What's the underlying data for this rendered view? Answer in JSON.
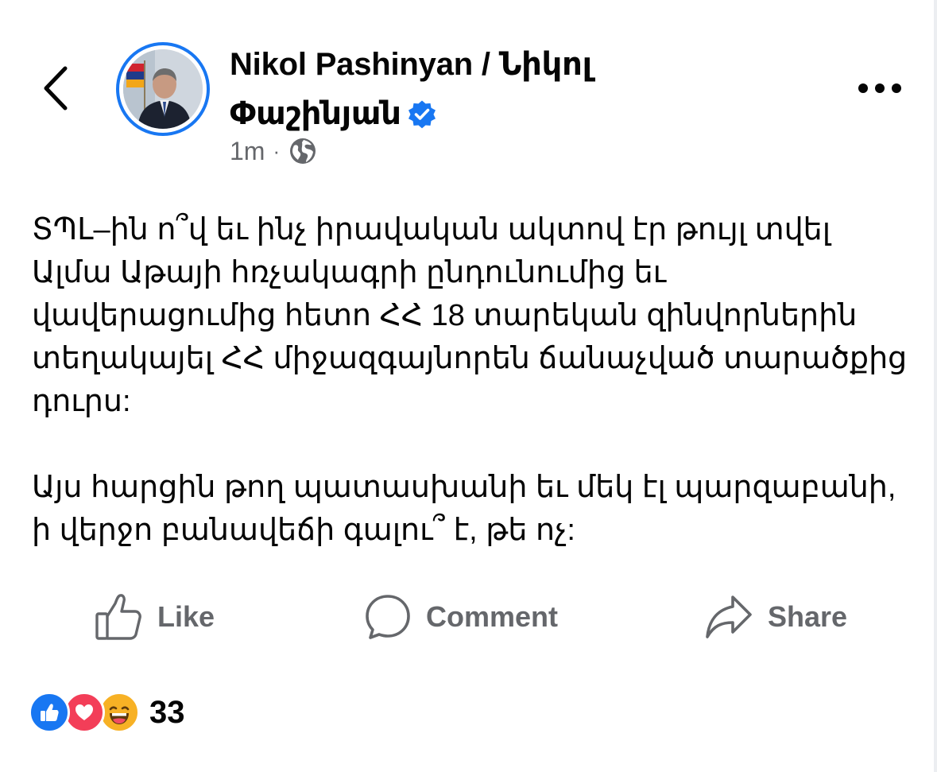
{
  "post": {
    "author": "Nikol Pashinyan / Նիկոլ Փաշինյան",
    "verified": true,
    "time": "1m",
    "privacy_icon": "globe-icon",
    "paragraphs": [
      "ՏՊԼ–ին ո՞վ եւ ինչ իրավական ակտով էր թույլ տվել Ալմա Աթայի հռչակագրի ընդունումից եւ վավերացումից հետո ՀՀ 18 տարեկան զինվորներին տեղակայել ՀՀ միջազգայնորեն ճանաչված տարածքից դուրս:",
      "Այս հարցին թող պատասխանի եւ մեկ էլ պարզաբանի, ի վերջո բանավեճի գալու՞ է, թե ոչ:"
    ]
  },
  "actions": {
    "like": "Like",
    "comment": "Comment",
    "share": "Share"
  },
  "reactions": {
    "types": [
      "like",
      "love",
      "haha"
    ],
    "count": "33"
  },
  "colors": {
    "accent": "#1877f2",
    "text": "#050505",
    "secondary": "#65676b",
    "love": "#f33e58",
    "haha": "#f7b125"
  }
}
